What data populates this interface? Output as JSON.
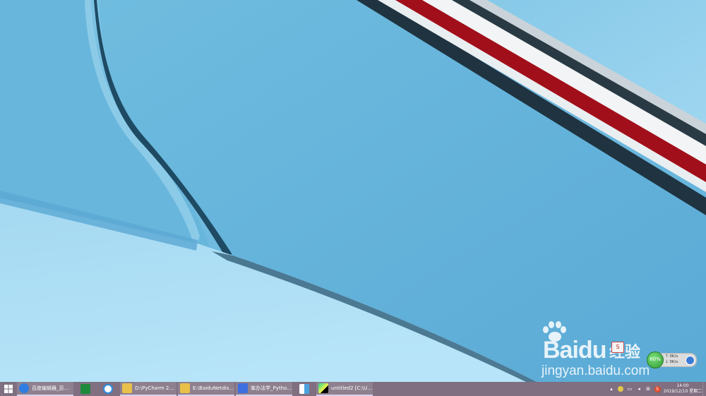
{
  "desktop": {
    "watermark": {
      "brand": "Bai",
      "brand_suffix": "du",
      "cn": "经验",
      "url": "jingyan.baidu.com"
    },
    "net_monitor": {
      "percent": "60%",
      "up": "↑  0K/s",
      "down": "↓  0K/s"
    },
    "tray_app_badge": "S"
  },
  "taskbar": {
    "items": [
      {
        "label": "百度编辑器_百度...",
        "icon": "browser-icon",
        "color": "#2f7de1"
      },
      {
        "label": "",
        "icon": "spreadsheet-icon",
        "color": "#1e8a3c"
      },
      {
        "label": "",
        "icon": "cloud-drive-icon",
        "color": "#2a8be0"
      },
      {
        "label": "D:\\PyCharm 201...",
        "icon": "folder-icon",
        "color": "#e8c04a"
      },
      {
        "label": "E:\\BaiduNetdisk...",
        "icon": "folder-icon",
        "color": "#e8c04a"
      },
      {
        "label": "笨办法学_Python....",
        "icon": "viewer-icon",
        "color": "#3b6fe0"
      },
      {
        "label": "",
        "icon": "window-icon",
        "color": "#4aa3e0"
      },
      {
        "label": "untitled2 [C:\\Us...",
        "icon": "pycharm-icon",
        "color": "#21d789"
      }
    ],
    "clock": {
      "time": "14:00",
      "date": "2019/12/10 星期二"
    },
    "ime": "S"
  }
}
